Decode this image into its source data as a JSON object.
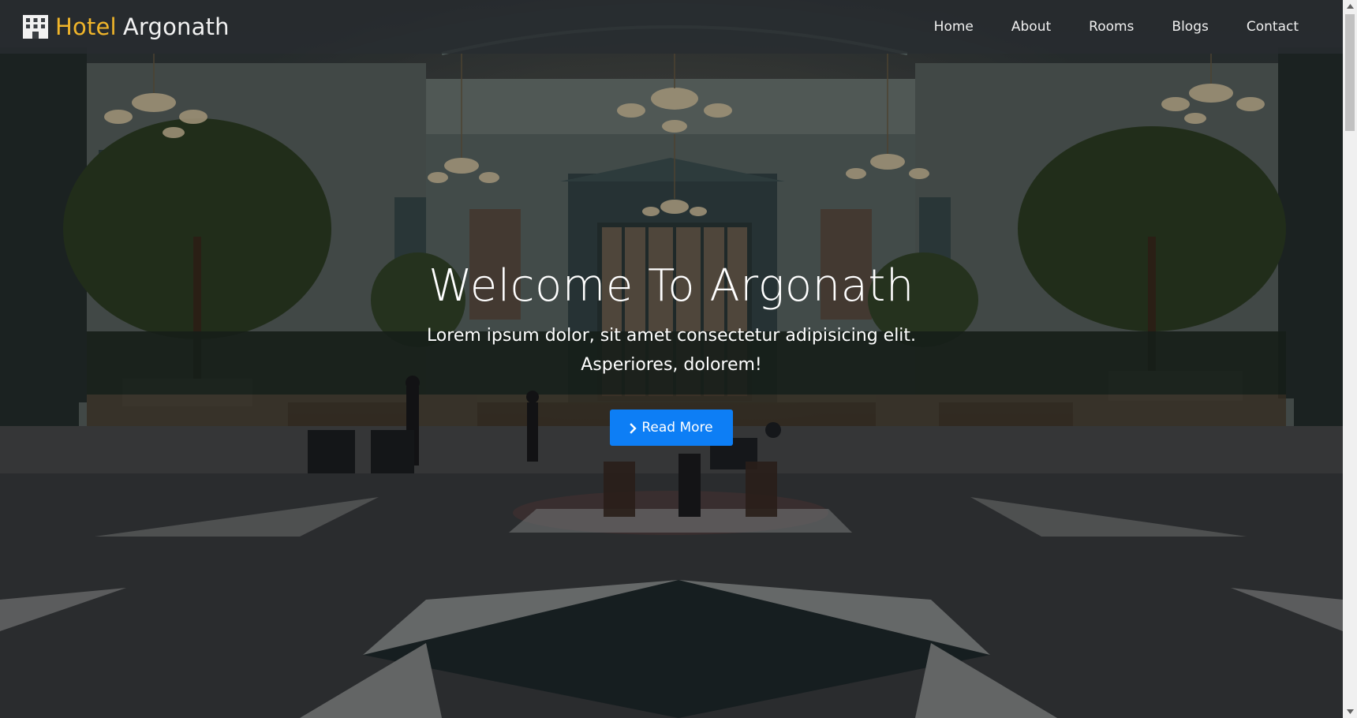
{
  "navbar": {
    "brand_first": "Hotel",
    "brand_second": "Argonath",
    "brand_icon": "building-icon",
    "links": [
      {
        "label": "Home"
      },
      {
        "label": "About"
      },
      {
        "label": "Rooms"
      },
      {
        "label": "Blogs"
      },
      {
        "label": "Contact"
      }
    ]
  },
  "hero": {
    "title": "Welcome To Argonath",
    "subtitle": "Lorem ipsum dolor, sit amet consectetur adipisicing elit. Asperiores, dolorem!",
    "button_label": "Read More",
    "button_icon": "chevron-right-icon",
    "background_image": "hotel atrium lobby"
  },
  "colors": {
    "brand_accent": "#f0b52a",
    "button": "#0d7ef5",
    "navbar_bg": "#282c30",
    "text": "#ffffff"
  }
}
